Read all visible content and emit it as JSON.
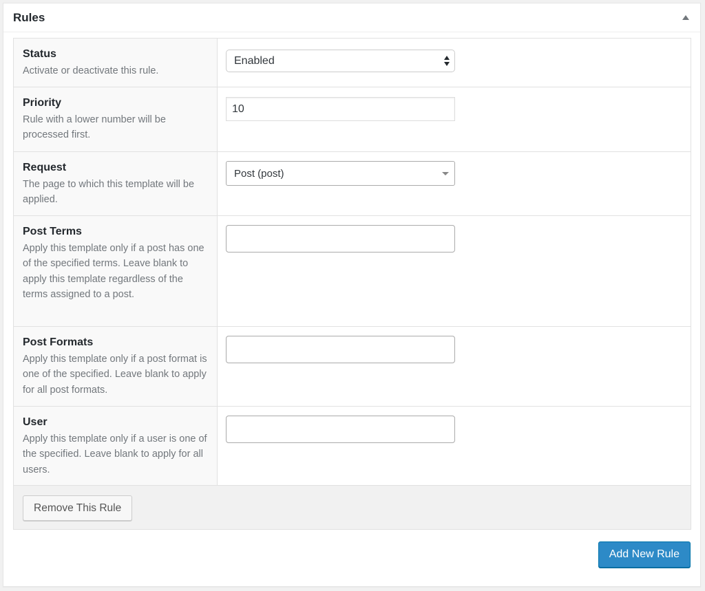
{
  "metabox": {
    "title": "Rules",
    "toggle_icon": "triangle-up-icon"
  },
  "rules": {
    "status": {
      "label": "Status",
      "description": "Activate or deactivate this rule.",
      "value": "Enabled"
    },
    "priority": {
      "label": "Priority",
      "description": "Rule with a lower number will be processed first.",
      "value": "10"
    },
    "request": {
      "label": "Request",
      "description": "The page to which this template will be applied.",
      "value": "Post (post)"
    },
    "post_terms": {
      "label": "Post Terms",
      "description": "Apply this template only if a post has one of the specified terms. Leave blank to apply this template regardless of the terms assigned to a post.",
      "value": ""
    },
    "post_formats": {
      "label": "Post Formats",
      "description": "Apply this template only if a post format is one of the specified. Leave blank to apply for all post formats.",
      "value": ""
    },
    "user": {
      "label": "User",
      "description": "Apply this template only if a user is one of the specified. Leave blank to apply for all users.",
      "value": ""
    }
  },
  "actions": {
    "remove_label": "Remove This Rule",
    "add_label": "Add New Rule"
  },
  "colors": {
    "primary_button": "#2d8ac7",
    "description_text": "#72777c",
    "label_cell_bg": "#f9f9f9"
  }
}
